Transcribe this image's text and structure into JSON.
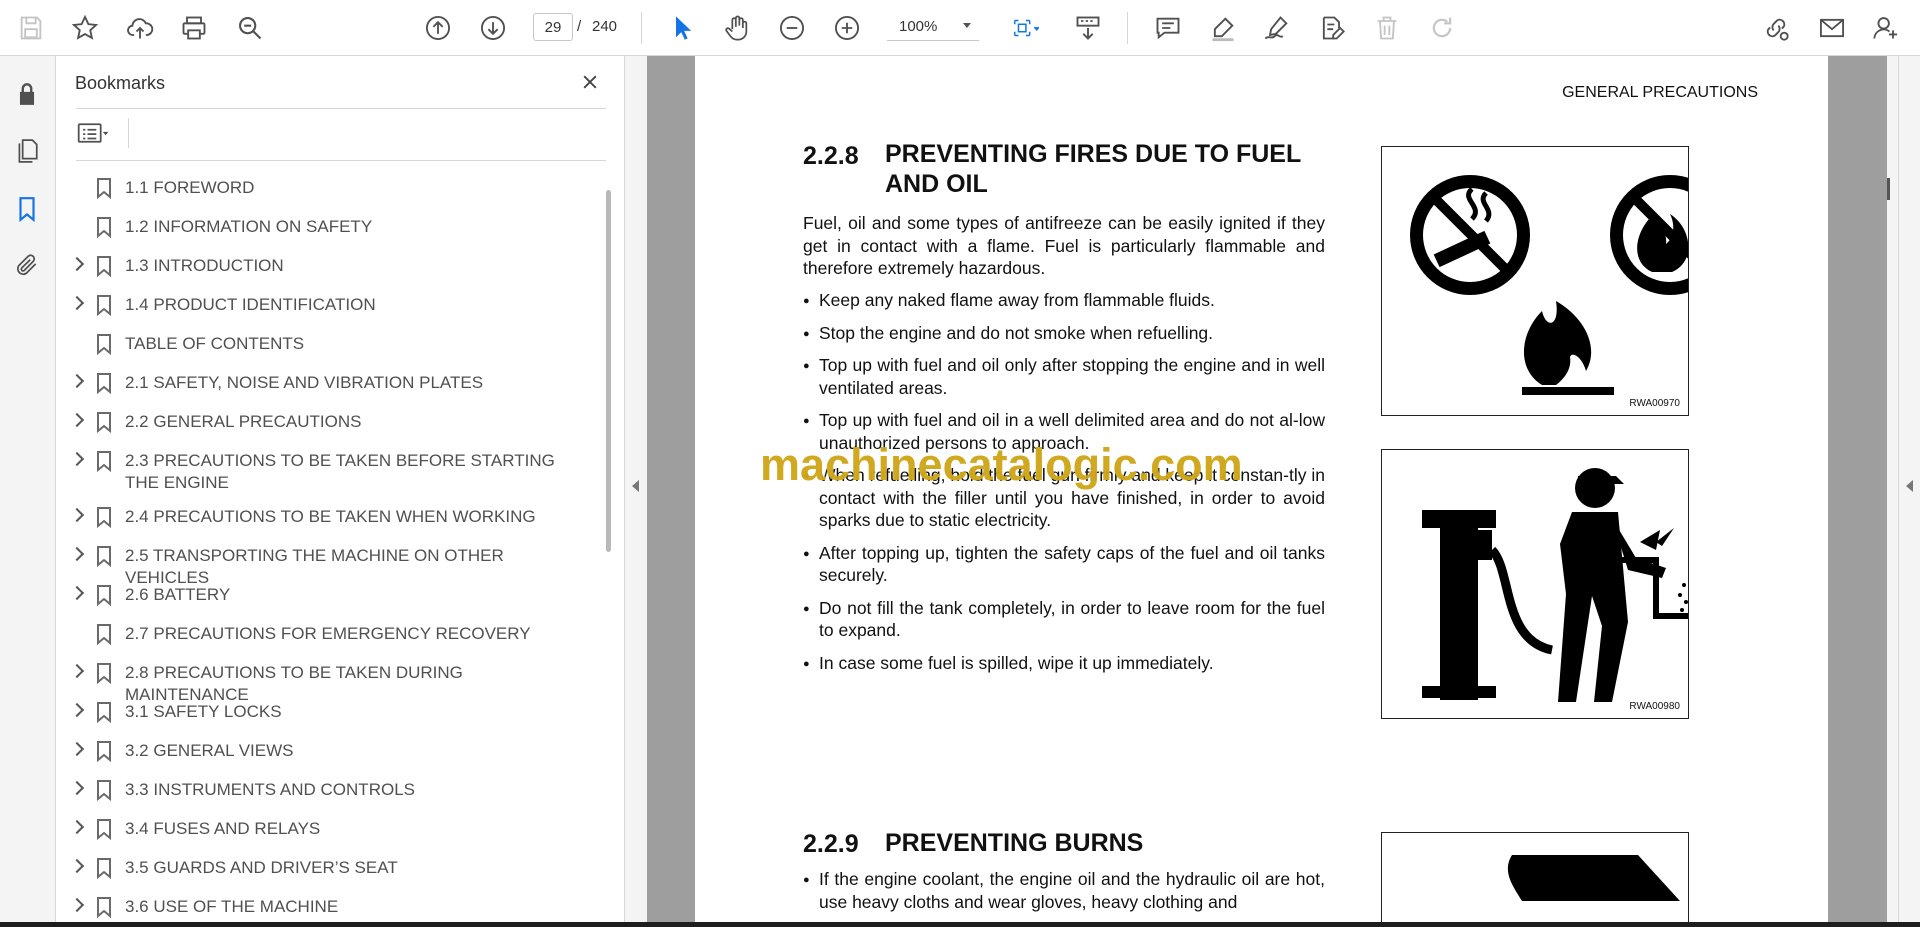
{
  "toolbar": {
    "page_current": "29",
    "page_separator": "/",
    "page_total": "240",
    "zoom": "100%",
    "icons": [
      "save-icon",
      "star-icon",
      "cloud-upload-icon",
      "print-icon",
      "find-icon",
      "page-up-icon",
      "page-down-icon",
      "select-cursor-icon",
      "hand-icon",
      "zoom-out-icon",
      "zoom-in-icon",
      "fit-page-icon",
      "scroll-mode-icon",
      "comment-icon",
      "highlight-icon",
      "sign-icon",
      "fill-sign-icon",
      "delete-icon",
      "redo-icon",
      "share-link-icon",
      "email-icon",
      "add-user-icon"
    ]
  },
  "accent_color": "#1473e6",
  "bookmarks": {
    "title": "Bookmarks",
    "items": [
      {
        "label": "1.1 FOREWORD",
        "expandable": false
      },
      {
        "label": "1.2 INFORMATION ON SAFETY",
        "expandable": false
      },
      {
        "label": "1.3 INTRODUCTION",
        "expandable": true
      },
      {
        "label": "1.4 PRODUCT IDENTIFICATION",
        "expandable": true
      },
      {
        "label": "TABLE OF CONTENTS",
        "expandable": false
      },
      {
        "label": "2.1 SAFETY, NOISE AND VIBRATION PLATES",
        "expandable": true
      },
      {
        "label": "2.2 GENERAL PRECAUTIONS",
        "expandable": true
      },
      {
        "label": "2.3 PRECAUTIONS TO BE TAKEN BEFORE STARTING THE ENGINE",
        "expandable": true
      },
      {
        "label": "2.4 PRECAUTIONS TO BE TAKEN WHEN WORKING",
        "expandable": true
      },
      {
        "label": "2.5 TRANSPORTING THE MACHINE ON OTHER VEHICLES",
        "expandable": true
      },
      {
        "label": "2.6 BATTERY",
        "expandable": true
      },
      {
        "label": "2.7 PRECAUTIONS FOR EMERGENCY RECOVERY",
        "expandable": false
      },
      {
        "label": "2.8 PRECAUTIONS TO BE TAKEN DURING MAINTENANCE",
        "expandable": true
      },
      {
        "label": "3.1 SAFETY LOCKS",
        "expandable": true
      },
      {
        "label": "3.2 GENERAL VIEWS",
        "expandable": true
      },
      {
        "label": "3.3 INSTRUMENTS AND CONTROLS",
        "expandable": true
      },
      {
        "label": "3.4 FUSES AND RELAYS",
        "expandable": true
      },
      {
        "label": "3.5 GUARDS AND DRIVER’S SEAT",
        "expandable": true
      },
      {
        "label": "3.6 USE OF THE MACHINE",
        "expandable": true
      }
    ]
  },
  "document": {
    "header": "GENERAL PRECAUTIONS",
    "section1": {
      "number": "2.2.8",
      "title_line1": "PREVENTING FIRES DUE TO FUEL",
      "title_line2": "AND OIL",
      "intro": "Fuel, oil and some types of antifreeze can be easily ignited if they get in contact with a flame. Fuel is particularly flammable and therefore extremely hazardous.",
      "bullets": [
        "Keep any naked flame away from flammable fluids.",
        "Stop the engine and do not smoke when refuelling.",
        "Top up with fuel and oil only after stopping the engine and in well ventilated areas.",
        "Top up with fuel and oil in a well delimited area and do not al-low unauthorized persons to approach.",
        "When refuelling, hold the fuel gun firmly and keep it constan-tly in contact with the filler until you have finished, in order to avoid sparks due to static electricity.",
        "After topping up, tighten the safety caps of the fuel and oil tanks securely.",
        "Do not fill the tank completely, in order to leave room for the fuel to expand.",
        "In case some fuel is spilled, wipe it up immediately."
      ],
      "figure1_code": "RWA00970",
      "figure2_code": "RWA00980"
    },
    "section2": {
      "number": "2.2.9",
      "title": "PREVENTING BURNS",
      "bullets": [
        "If the engine coolant, the engine oil and the hydraulic oil are hot, use heavy cloths and wear gloves, heavy clothing and"
      ]
    },
    "watermark": "machinecatalogic.com"
  }
}
